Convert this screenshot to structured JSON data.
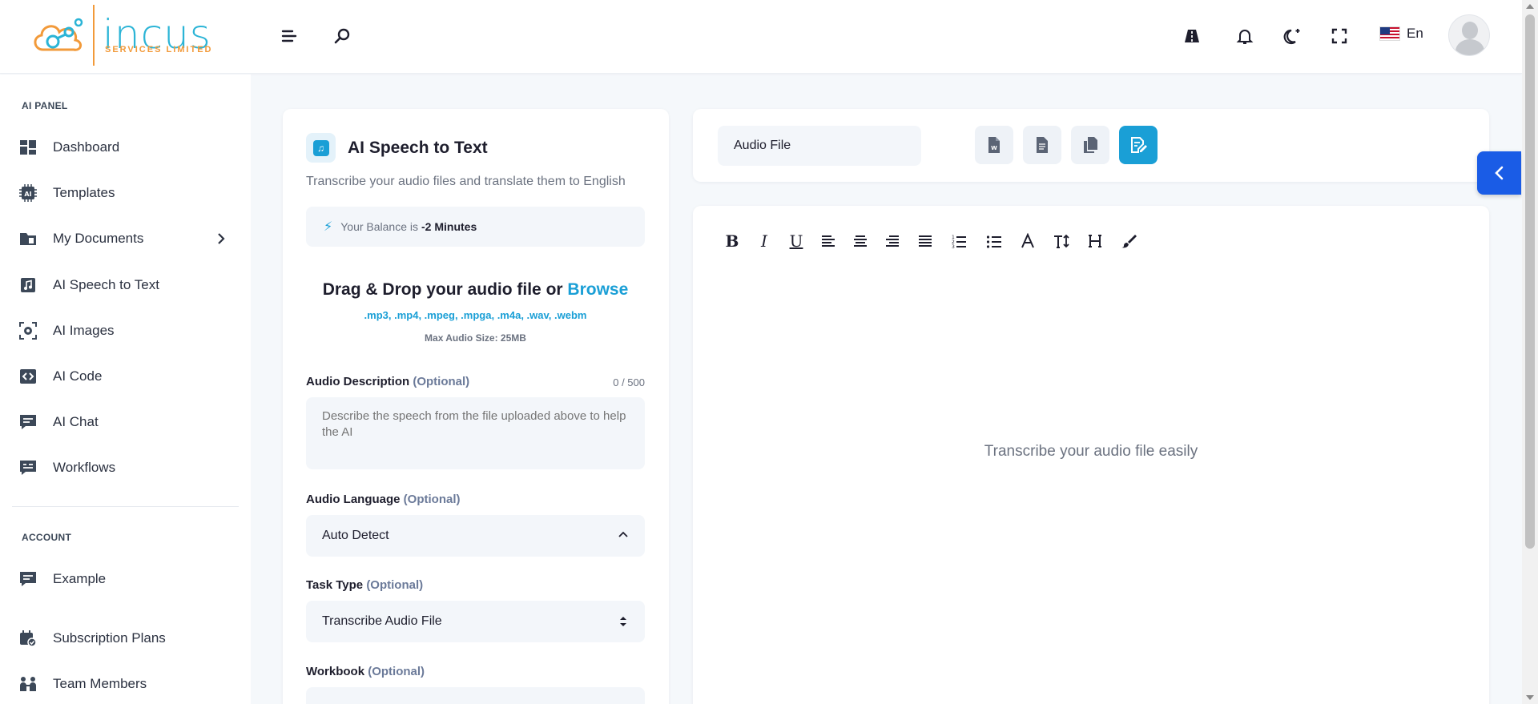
{
  "brand": {
    "name": "incus",
    "tagline": "SERVICES LIMITED"
  },
  "header": {
    "language": "En"
  },
  "sidebar": {
    "section_ai": "AI PANEL",
    "section_account": "ACCOUNT",
    "items": [
      {
        "label": "Dashboard"
      },
      {
        "label": "Templates"
      },
      {
        "label": "My Documents"
      },
      {
        "label": "AI Speech to Text"
      },
      {
        "label": "AI Images"
      },
      {
        "label": "AI Code"
      },
      {
        "label": "AI Chat"
      },
      {
        "label": "Workflows"
      }
    ],
    "account_items": [
      {
        "label": "Example"
      },
      {
        "label": "Subscription Plans"
      },
      {
        "label": "Team Members"
      }
    ]
  },
  "tool": {
    "title": "AI Speech to Text",
    "subtitle": "Transcribe your audio files and translate them to English",
    "balance_prefix": "Your Balance is",
    "balance_value": "-2 Minutes",
    "drop_text": "Drag & Drop your audio file or",
    "browse_label": "Browse",
    "formats": ".mp3, .mp4, .mpeg, .mpga, .m4a, .wav, .webm",
    "max_size": "Max Audio Size: 25MB",
    "description_label": "Audio Description",
    "description_optional": "(Optional)",
    "description_counter": "0 / 500",
    "description_placeholder": "Describe the speech from the file uploaded above to help the AI",
    "language_label": "Audio Language",
    "language_optional": "(Optional)",
    "language_value": "Auto Detect",
    "task_label": "Task Type",
    "task_optional": "(Optional)",
    "task_value": "Transcribe Audio File",
    "workbook_label": "Workbook",
    "workbook_optional": "(Optional)"
  },
  "document": {
    "name_value": "Audio File",
    "editor_placeholder": "Transcribe your audio file easily"
  },
  "colors": {
    "accent": "#1a9fd6",
    "float_button": "#1a5ce6",
    "logo_orange": "#f29a3a"
  }
}
